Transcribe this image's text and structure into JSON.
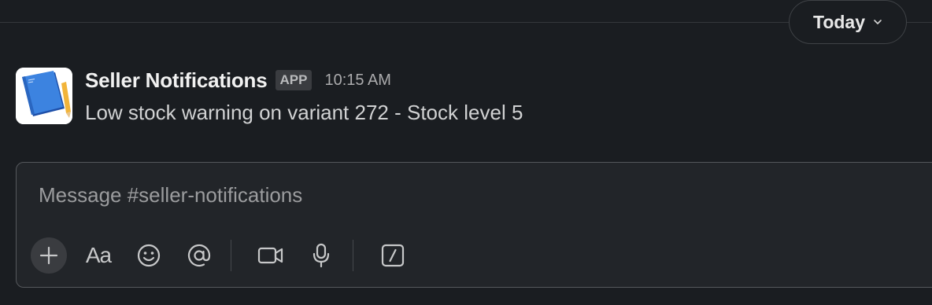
{
  "divider": {
    "date_label": "Today"
  },
  "message": {
    "sender": "Seller Notifications",
    "badge": "APP",
    "time": "10:15 AM",
    "text": "Low stock warning on variant 272 - Stock level 5",
    "avatar_icon": "notebook-icon"
  },
  "composer": {
    "placeholder": "Message #seller-notifications",
    "value": "",
    "toolbar": {
      "plus_icon": "plus-icon",
      "format_label": "Aa",
      "emoji_icon": "emoji-icon",
      "mention_icon": "at-mention-icon",
      "video_icon": "video-icon",
      "mic_icon": "microphone-icon",
      "shortcut_icon": "slash-shortcut-icon"
    }
  },
  "colors": {
    "background": "#1a1d21",
    "composer_bg": "#222529",
    "avatar_blue": "#2f6fd0"
  }
}
